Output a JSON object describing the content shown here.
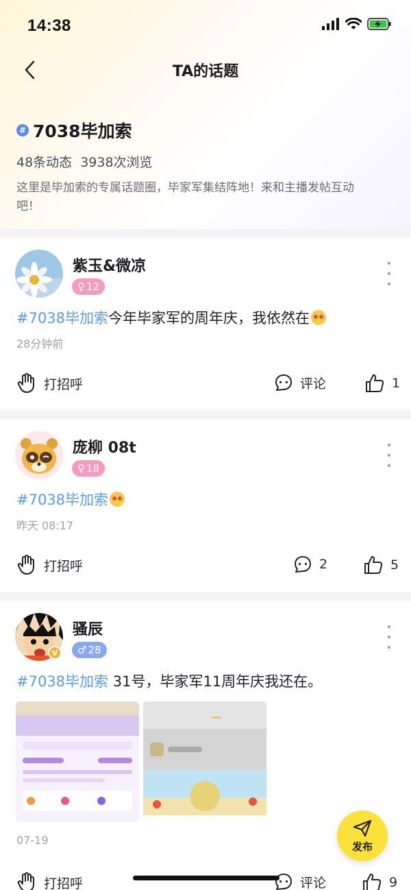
{
  "status_bar": {
    "time": "14:38"
  },
  "nav": {
    "title": "TA的话题"
  },
  "topic": {
    "title": "7038毕加索",
    "posts_count": "48条动态",
    "views_count": "3938次浏览",
    "description": "这里是毕加索的专属话题圈，毕家军集结阵地！来和主播发帖互动吧！"
  },
  "actions_labels": {
    "greet": "打招呼",
    "comment": "评论"
  },
  "posts": [
    {
      "username": "紫玉&微凉",
      "gender_symbol": "♀",
      "level": "12",
      "tag": "#7038毕加索",
      "text": "今年毕家军的周年庆，我依然在",
      "time": "28分钟前",
      "comment_label": "评论",
      "likes": "1"
    },
    {
      "username": "庞柳 08t",
      "gender_symbol": "♀",
      "level": "18",
      "tag": "#7038毕加索",
      "text": "",
      "time": "昨天 08:17",
      "comments": "2",
      "likes": "5"
    },
    {
      "username": "骚辰",
      "gender_symbol": "♂",
      "level": "28",
      "tag": "#7038毕加索",
      "text": "31号，毕家军11周年庆我还在。",
      "time": "07-19",
      "comment_label": "评论",
      "likes": "9"
    }
  ],
  "fab": {
    "label": "发布"
  },
  "colors": {
    "accent_blue": "#5d9be8",
    "fab_yellow": "#fae13c",
    "badge_pink": "#f59bbd",
    "badge_blue": "#8aa7f2"
  }
}
